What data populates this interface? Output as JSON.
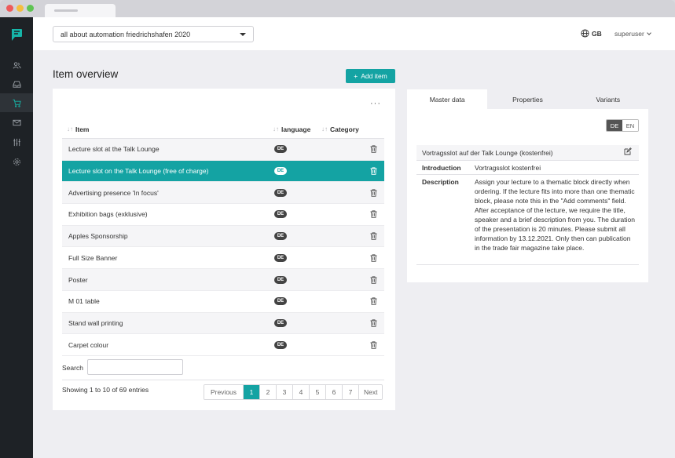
{
  "header": {
    "event_select": "all about automation friedrichshafen 2020",
    "language_code": "GB",
    "username": "superuser"
  },
  "page": {
    "title": "Item overview",
    "add_button": "Add item",
    "more_label": "···"
  },
  "table": {
    "columns": {
      "item": "Item",
      "language": "language",
      "category": "Category"
    },
    "rows": [
      {
        "name": "Lecture slot at the Talk Lounge",
        "lang": "DE"
      },
      {
        "name": "Lecture slot on the Talk Lounge (free of charge)",
        "lang": "DE",
        "selected": true
      },
      {
        "name": "Advertising presence 'In focus'",
        "lang": "DE"
      },
      {
        "name": "Exhibition bags (exklusive)",
        "lang": "DE"
      },
      {
        "name": "Apples Sponsorship",
        "lang": "DE"
      },
      {
        "name": "Full Size Banner",
        "lang": "DE"
      },
      {
        "name": "Poster",
        "lang": "DE"
      },
      {
        "name": "M 01 table",
        "lang": "DE"
      },
      {
        "name": "Stand wall printing",
        "lang": "DE"
      },
      {
        "name": "Carpet colour",
        "lang": "DE"
      }
    ],
    "search_label": "Search",
    "search_value": "",
    "entries_text": "Showing 1 to 10 of 69 entries",
    "pagination": {
      "previous": "Previous",
      "pages": [
        "1",
        "2",
        "3",
        "4",
        "5",
        "6",
        "7"
      ],
      "current": "1",
      "next": "Next"
    }
  },
  "detail": {
    "tabs": [
      "Master data",
      "Properties",
      "Variants"
    ],
    "active_tab": "Master data",
    "lang_switch": [
      "DE",
      "EN"
    ],
    "active_lang": "DE",
    "title": "Vortragsslot auf der Talk Lounge (kostenfrei)",
    "introduction_label": "Introduction",
    "introduction": "Vortragsslot kostenfrei",
    "description_label": "Description",
    "description": "Assign your lecture to a thematic block directly when ordering. If the lecture fits into more than one thematic block, please note this in the \"Add comments\" field. After acceptance of the lecture, we require the title, speaker and a brief description from you. The duration of the presentation is 20 minutes. Please submit all information by 13.12.2021. Only then can publication in the trade fair magazine take place."
  },
  "colors": {
    "accent": "#14a3a3",
    "sidebar": "#1e2226"
  },
  "icons": [
    "logo-icon",
    "users-icon",
    "inbox-icon",
    "cart-icon",
    "mail-icon",
    "sliders-icon",
    "settings-icon",
    "globe-icon",
    "plus-icon",
    "trash-icon",
    "edit-icon"
  ]
}
